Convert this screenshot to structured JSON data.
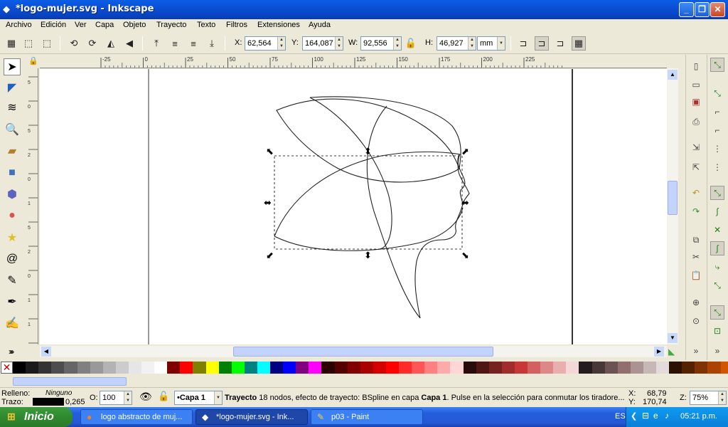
{
  "window": {
    "title": "*logo-mujer.svg - Inkscape",
    "min": "_",
    "max": "❐",
    "close": "✕"
  },
  "menu": [
    "Archivo",
    "Edición",
    "Ver",
    "Capa",
    "Objeto",
    "Trayecto",
    "Texto",
    "Filtros",
    "Extensiones",
    "Ayuda"
  ],
  "toolbar": {
    "x_label": "X:",
    "x_value": "62,564",
    "y_label": "Y:",
    "y_value": "164,087",
    "w_label": "W:",
    "w_value": "92,556",
    "h_label": "H:",
    "h_value": "46,927",
    "unit": "mm"
  },
  "rulers": {
    "h": [
      "-25",
      "0",
      "25",
      "50",
      "75",
      "100",
      "125",
      "150",
      "175",
      "200",
      "225"
    ],
    "v": [
      "5",
      "0",
      "5",
      "2",
      "0",
      "1",
      "5",
      "2",
      "0",
      "1",
      "1",
      "0"
    ]
  },
  "style": {
    "fill_label": "Relleno:",
    "fill_value": "Ninguno",
    "stroke_label": "Trazo:",
    "stroke_width": "0,265",
    "opacity_label": "O:",
    "opacity_value": "100"
  },
  "layer": "•Capa 1",
  "status_msg_bold": "Trayecto",
  "status_msg": " 18 nodos, efecto de trayecto: BSpline en capa ",
  "status_layer": "Capa 1",
  "status_msg2": ". Pulse en la selección para conmutar los tiradore...",
  "coords": {
    "x_label": "X:",
    "x": "68,79",
    "y_label": "Y:",
    "y": "170,74"
  },
  "zoom": {
    "label": "Z:",
    "value": "75%"
  },
  "taskbar": {
    "start": "Inicio",
    "tasks": [
      "logo abstracto de muj...",
      "*logo-mujer.svg - Ink...",
      "p03 - Paint"
    ],
    "lang": "ES",
    "time": "05:21 p.m."
  },
  "colors": {
    "accent": "#0a5fe6",
    "canvas_bg": "#ffffff",
    "chrome": "#ece9d8"
  }
}
